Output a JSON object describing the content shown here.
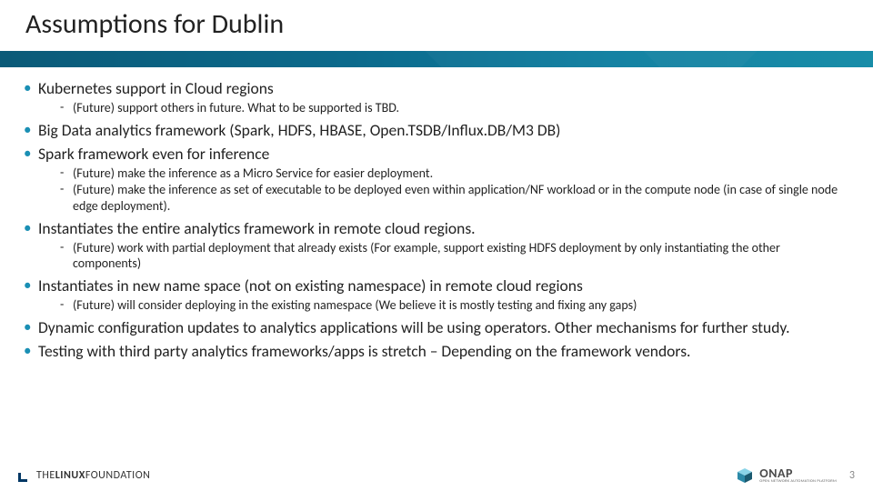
{
  "slide": {
    "title": "Assumptions for Dublin",
    "page_number": "3"
  },
  "bullets": {
    "b1": "Kubernetes support in Cloud regions",
    "b1_s1": "(Future) support others in future. What to be supported is TBD.",
    "b2": "Big Data analytics framework (Spark, HDFS, HBASE, Open.TSDB/Influx.DB/M3 DB)",
    "b3": "Spark framework even for inference",
    "b3_s1": "(Future) make the inference as a Micro Service for easier deployment.",
    "b3_s2": "(Future) make the inference as set of executable to  be deployed even within application/NF workload or in the compute node (in case of single node edge deployment).",
    "b4": "Instantiates the entire analytics framework in remote cloud regions.",
    "b4_s1": "(Future) work with partial deployment that already exists (For example, support existing HDFS deployment by only instantiating the other components)",
    "b5": "Instantiates in new name space (not on existing namespace) in remote cloud regions",
    "b5_s1": "(Future) will consider deploying in the existing namespace (We believe it is mostly testing and fixing any gaps)",
    "b6": "Dynamic configuration updates to analytics applications will be using operators. Other mechanisms for further study.",
    "b7": "Testing with third party analytics frameworks/apps is stretch – Depending on the framework vendors."
  },
  "footer": {
    "linux_foundation_prefix": "THE",
    "linux_foundation_bold": "LINUX",
    "linux_foundation_suffix": "FOUNDATION",
    "onap_main": "ONAP",
    "onap_tagline": "OPEN NETWORK AUTOMATION PLATFORM"
  }
}
